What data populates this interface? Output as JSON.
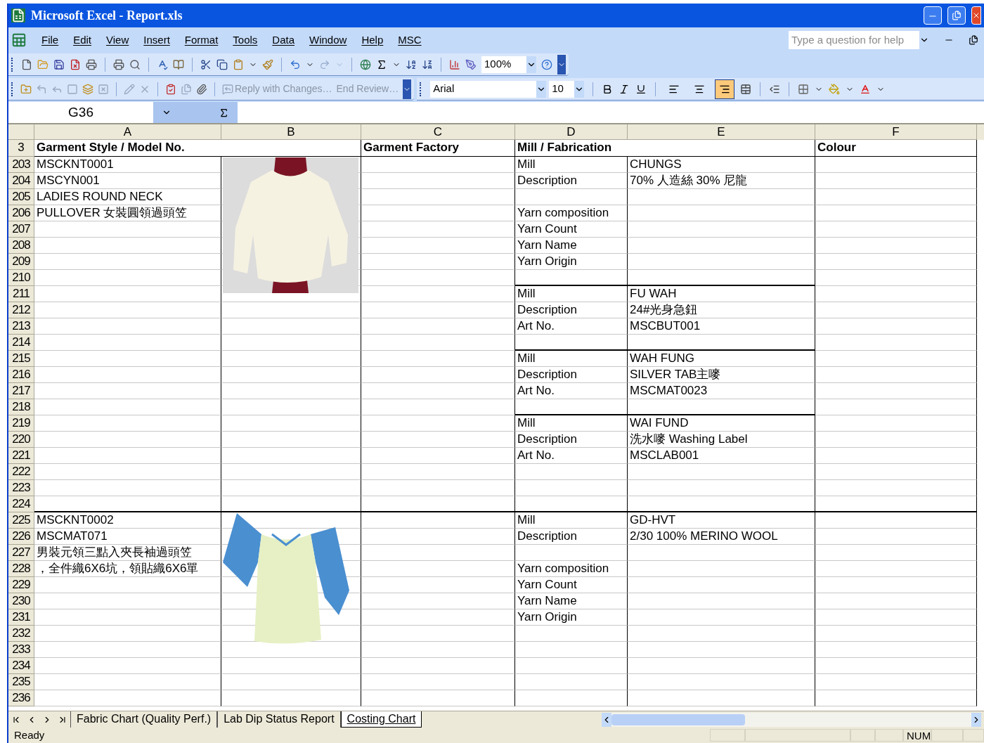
{
  "window": {
    "title": "Microsoft Excel - Report.xls"
  },
  "menu": [
    "File",
    "Edit",
    "View",
    "Insert",
    "Format",
    "Tools",
    "Data",
    "Window",
    "Help",
    "MSC"
  ],
  "help_box": {
    "placeholder": "Type a question for help"
  },
  "standard_toolbar": {
    "zoom": "100%"
  },
  "review_toolbar": {
    "reply": "Reply with Changes…",
    "end_review": "End Review…"
  },
  "formatting_toolbar": {
    "font": "Arial",
    "size": "10",
    "alignment": [
      {
        "kind": "left",
        "selected": false
      },
      {
        "kind": "center",
        "selected": false
      },
      {
        "kind": "right",
        "selected": true
      }
    ]
  },
  "name_box": "G36",
  "columns": [
    "A",
    "B",
    "C",
    "D",
    "E",
    "F"
  ],
  "header_row": {
    "number": "3",
    "a": "Garment Style / Model No.",
    "c": "Garment Factory",
    "d": "Mill / Fabrication",
    "f": "Colour"
  },
  "rows": [
    {
      "number": "203",
      "a": "MSCKNT0001",
      "d": "Mill",
      "e": "CHUNGS",
      "photo": true
    },
    {
      "number": "204",
      "a": "MSCYN001",
      "d": "Description",
      "e": "70% 人造絲 30% 尼龍"
    },
    {
      "number": "205",
      "a": "LADIES ROUND NECK"
    },
    {
      "number": "206",
      "a": "PULLOVER 女裝圓領過頭笠",
      "d": "Yarn composition"
    },
    {
      "number": "207",
      "d": "Yarn Count"
    },
    {
      "number": "208",
      "d": "Yarn Name"
    },
    {
      "number": "209",
      "d": "Yarn Origin"
    },
    {
      "number": "210",
      "box_end": true
    },
    {
      "number": "211",
      "d": "Mill",
      "e": "FU WAH"
    },
    {
      "number": "212",
      "d": "Description",
      "e": "24#光身急鈕"
    },
    {
      "number": "213",
      "d": "Art No.",
      "e": "MSCBUT001"
    },
    {
      "number": "214",
      "box_end": true
    },
    {
      "number": "215",
      "d": "Mill",
      "e": "WAH FUNG"
    },
    {
      "number": "216",
      "d": "Description",
      "e": "SILVER TAB主嘜"
    },
    {
      "number": "217",
      "d": "Art No.",
      "e": "MSCMAT0023"
    },
    {
      "number": "218",
      "box_end": true
    },
    {
      "number": "219",
      "d": "Mill",
      "e": "WAI FUND"
    },
    {
      "number": "220",
      "d": "Description",
      "e": "洗水嘜 Washing Label"
    },
    {
      "number": "221",
      "d": "Art No.",
      "e": "MSCLAB001"
    },
    {
      "number": "222"
    },
    {
      "number": "223"
    },
    {
      "number": "224",
      "section_end": true
    },
    {
      "number": "225",
      "a": "MSCKNT0002",
      "d": "Mill",
      "e": "GD-HVT",
      "photo": true
    },
    {
      "number": "226",
      "a": "MSCMAT071",
      "d": "Description",
      "e": "2/30 100% MERINO WOOL"
    },
    {
      "number": "227",
      "a": "男裝元領三點入夾長袖過頭笠"
    },
    {
      "number": "228",
      "a": "，全件織6X6坑，領貼織6X6單",
      "d": "Yarn composition"
    },
    {
      "number": "229",
      "d": "Yarn Count"
    },
    {
      "number": "230",
      "d": "Yarn Name"
    },
    {
      "number": "231",
      "d": "Yarn Origin"
    },
    {
      "number": "232"
    },
    {
      "number": "233"
    },
    {
      "number": "234"
    },
    {
      "number": "235"
    },
    {
      "number": "236"
    }
  ],
  "sheet_tabs": [
    {
      "label": "Fabric Chart (Quality Perf.)",
      "selected": false
    },
    {
      "label": "Lab Dip Status Report",
      "selected": false
    },
    {
      "label": "Costing Chart",
      "selected": true
    }
  ],
  "status": {
    "text": "Ready",
    "num": "NUM"
  }
}
